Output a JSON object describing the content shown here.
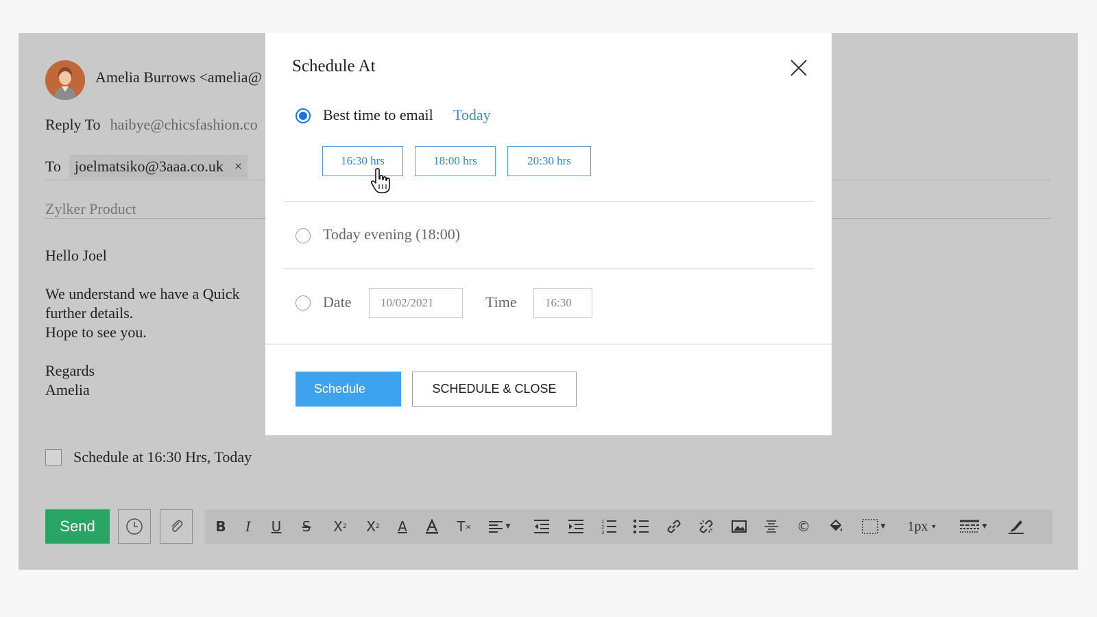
{
  "composer": {
    "from": "Amelia Burrows <amelia@",
    "reply_to_label": "Reply To",
    "reply_to_value": "haibye@chicsfashion.co",
    "to_label": "To",
    "to_chip": "joelmatsiko@3aaa.co.uk",
    "to_chip_remove": "×",
    "subject": "Zylker Product",
    "body": {
      "greeting": "Hello Joel",
      "line1": "We understand we have a Quick",
      "line2": "further details.",
      "line3": "Hope to see you.",
      "regards": "Regards",
      "signature": "Amelia"
    },
    "schedule_checkbox_label": "Schedule at 16:30 Hrs, Today",
    "send_label": "Send",
    "line_width_label": "1px"
  },
  "modal": {
    "title": "Schedule At",
    "best_time_label": "Best time to email",
    "best_time_day": "Today",
    "time_slots": [
      "16:30 hrs",
      "18:00 hrs",
      "20:30 hrs"
    ],
    "evening_label": "Today evening (18:00)",
    "date_label": "Date",
    "date_value": "10/02/2021",
    "time_label": "Time",
    "time_value": "16:30",
    "schedule_button": "Schedule",
    "schedule_close_button": "SCHEDULE & CLOSE"
  },
  "colors": {
    "send": "#28a565",
    "primary": "#3ea3ef",
    "link": "#3a8fd6",
    "radio": "#1a73e8"
  }
}
